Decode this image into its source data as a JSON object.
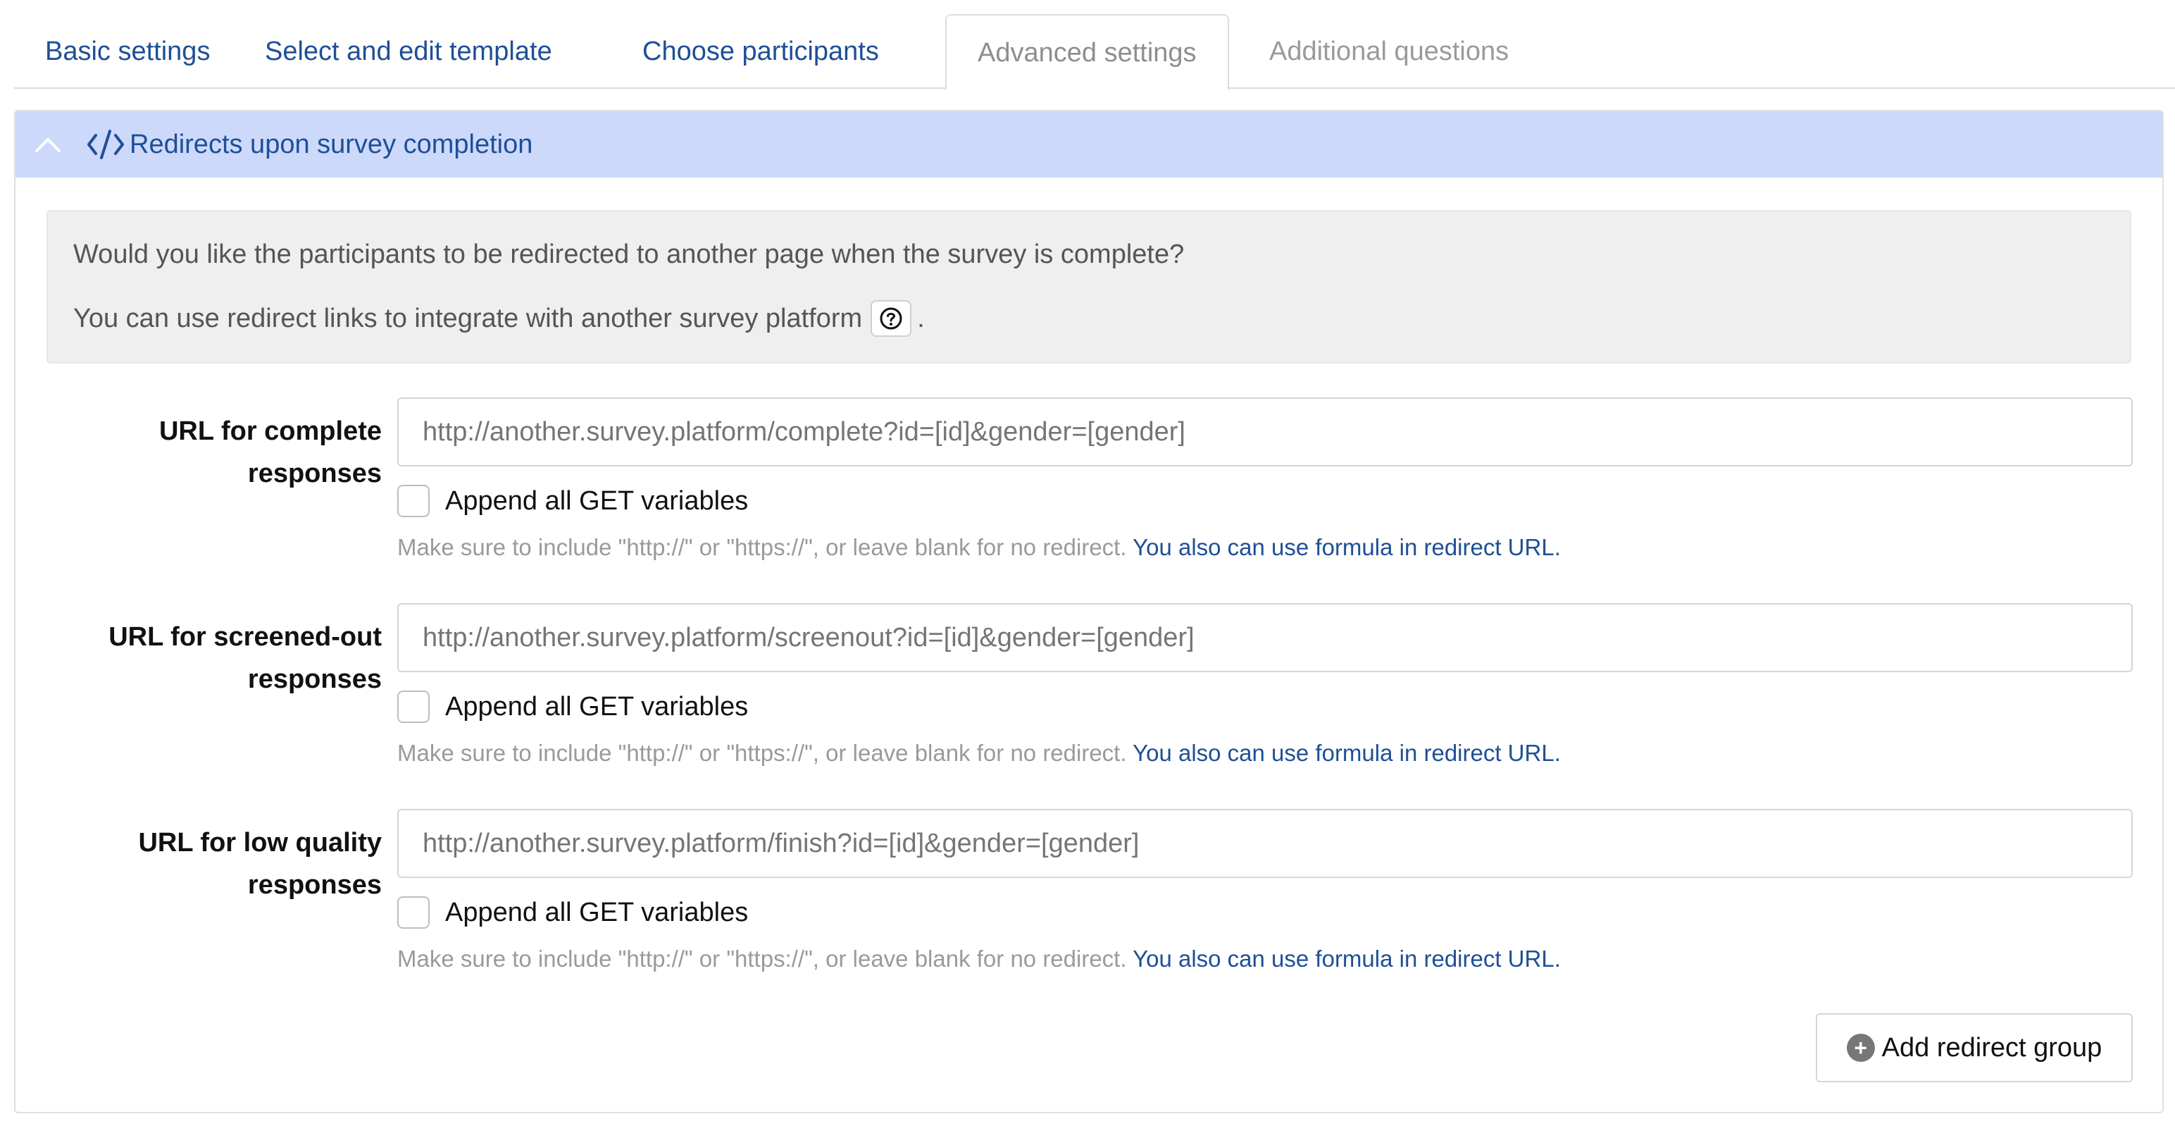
{
  "tabs": [
    {
      "label": "Basic settings",
      "state": "link"
    },
    {
      "label": "Select and edit template",
      "state": "link"
    },
    {
      "label": "Choose participants",
      "state": "link"
    },
    {
      "label": "Advanced settings",
      "state": "active"
    },
    {
      "label": "Additional questions",
      "state": "disabled"
    }
  ],
  "panel": {
    "title": "Redirects upon survey completion",
    "collapse_icon": "chevron-up-icon",
    "title_icon": "code-icon"
  },
  "info": {
    "line1": "Would you like the participants to be redirected to another page when the survey is complete?",
    "line2": "You can use redirect links to integrate with another survey platform",
    "line2_end": ".",
    "help_icon": "question-circle-icon"
  },
  "redirects": [
    {
      "label_line1": "URL for complete",
      "label_line2": "responses",
      "placeholder": "http://another.survey.platform/complete?id=[id]&gender=[gender]",
      "checkbox_label": "Append all GET variables",
      "checked": false,
      "hint": "Make sure to include \"http://\" or \"https://\", or leave blank for no redirect.",
      "hint_link": "You also can use formula in redirect URL."
    },
    {
      "label_line1": "URL for screened-out",
      "label_line2": "responses",
      "placeholder": "http://another.survey.platform/screenout?id=[id]&gender=[gender]",
      "checkbox_label": "Append all GET variables",
      "checked": false,
      "hint": "Make sure to include \"http://\" or \"https://\", or leave blank for no redirect.",
      "hint_link": "You also can use formula in redirect URL."
    },
    {
      "label_line1": "URL for low quality",
      "label_line2": "responses",
      "placeholder": "http://another.survey.platform/finish?id=[id]&gender=[gender]",
      "checkbox_label": "Append all GET variables",
      "checked": false,
      "hint": "Make sure to include \"http://\" or \"https://\", or leave blank for no redirect.",
      "hint_link": "You also can use formula in redirect URL."
    }
  ],
  "add_button": {
    "label": "Add redirect group",
    "icon": "plus-circle-icon"
  },
  "colors": {
    "link": "#1f4f96",
    "header_bg": "#ccd9fb",
    "info_bg": "#efefef",
    "muted": "#9a9a9a"
  }
}
